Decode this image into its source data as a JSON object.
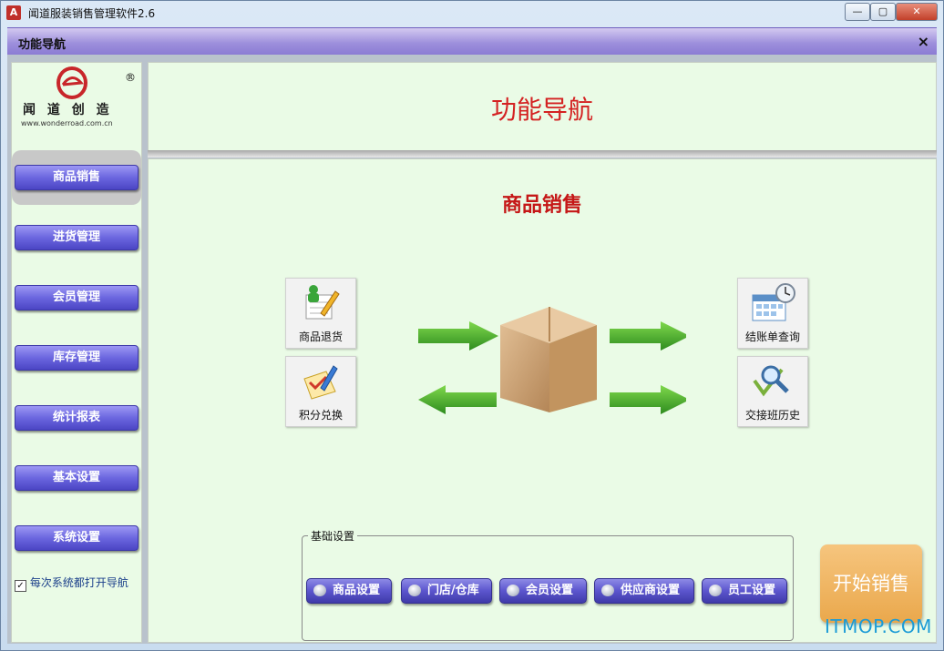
{
  "window": {
    "title": "闻道服装销售管理软件2.6",
    "minimize": "—",
    "restore": "▢",
    "close": "✕"
  },
  "navbar": {
    "title": "功能导航",
    "close": "×"
  },
  "logo": {
    "brand": "闻 道 创 造",
    "url": "www.wonderroad.com.cn",
    "registered": "®"
  },
  "sidebar": {
    "items": [
      {
        "label": "商品销售"
      },
      {
        "label": "进货管理"
      },
      {
        "label": "会员管理"
      },
      {
        "label": "库存管理"
      },
      {
        "label": "统计报表"
      },
      {
        "label": "基本设置"
      },
      {
        "label": "系统设置"
      }
    ],
    "checkbox_label": "每次系统都打开导航",
    "checkbox_checked": true
  },
  "banner": {
    "title": "功能导航"
  },
  "main": {
    "section_title": "商品销售",
    "tiles": {
      "return": "商品退货",
      "points": "积分兑换",
      "bill_query": "结账单查询",
      "shift_history": "交接班历史"
    }
  },
  "basic_settings": {
    "legend": "基础设置",
    "buttons": [
      {
        "label": "商品设置"
      },
      {
        "label": "门店/仓库"
      },
      {
        "label": "会员设置"
      },
      {
        "label": "供应商设置"
      },
      {
        "label": "员工设置"
      }
    ]
  },
  "start_button": "开始销售",
  "watermark": "ITMOP.COM"
}
